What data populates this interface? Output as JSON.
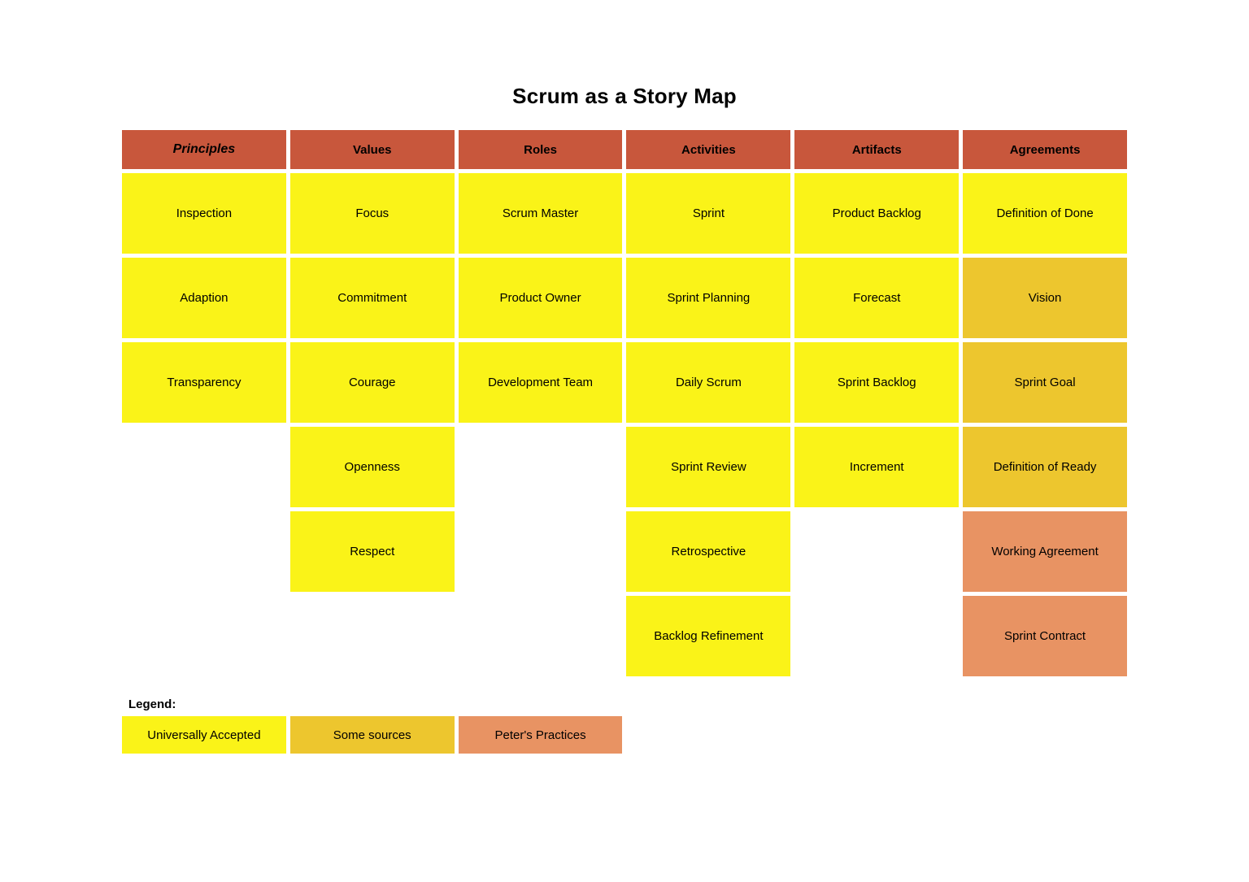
{
  "title": "Scrum as a Story Map",
  "palette": {
    "header": "#c8573c",
    "yellow": "#faf318",
    "gold": "#edc62e",
    "orange": "#e89363",
    "background": "#ffffff",
    "text": "#000000"
  },
  "columns": [
    {
      "header": "Principles",
      "header_style": "bold-italic",
      "cells": [
        {
          "label": "Inspection",
          "tone": "yellow"
        },
        {
          "label": "Adaption",
          "tone": "yellow"
        },
        {
          "label": "Transparency",
          "tone": "yellow"
        }
      ]
    },
    {
      "header": "Values",
      "header_style": "bold",
      "cells": [
        {
          "label": "Focus",
          "tone": "yellow"
        },
        {
          "label": "Commitment",
          "tone": "yellow"
        },
        {
          "label": "Courage",
          "tone": "yellow"
        },
        {
          "label": "Openness",
          "tone": "yellow"
        },
        {
          "label": "Respect",
          "tone": "yellow"
        }
      ]
    },
    {
      "header": "Roles",
      "header_style": "bold",
      "cells": [
        {
          "label": "Scrum Master",
          "tone": "yellow"
        },
        {
          "label": "Product Owner",
          "tone": "yellow"
        },
        {
          "label": "Development Team",
          "tone": "yellow"
        }
      ]
    },
    {
      "header": "Activities",
      "header_style": "bold",
      "cells": [
        {
          "label": "Sprint",
          "tone": "yellow"
        },
        {
          "label": "Sprint Planning",
          "tone": "yellow"
        },
        {
          "label": "Daily Scrum",
          "tone": "yellow"
        },
        {
          "label": "Sprint Review",
          "tone": "yellow"
        },
        {
          "label": "Retrospective",
          "tone": "yellow"
        },
        {
          "label": "Backlog Refinement",
          "tone": "yellow"
        }
      ]
    },
    {
      "header": "Artifacts",
      "header_style": "bold",
      "cells": [
        {
          "label": "Product Backlog",
          "tone": "yellow"
        },
        {
          "label": "Forecast",
          "tone": "yellow"
        },
        {
          "label": "Sprint Backlog",
          "tone": "yellow"
        },
        {
          "label": "Increment",
          "tone": "yellow"
        }
      ]
    },
    {
      "header": "Agreements",
      "header_style": "bold",
      "cells": [
        {
          "label": "Definition of Done",
          "tone": "yellow"
        },
        {
          "label": "Vision",
          "tone": "gold"
        },
        {
          "label": "Sprint Goal",
          "tone": "gold"
        },
        {
          "label": "Definition of Ready",
          "tone": "gold"
        },
        {
          "label": "Working Agreement",
          "tone": "orange"
        },
        {
          "label": "Sprint Contract",
          "tone": "orange"
        }
      ]
    }
  ],
  "legend": {
    "label": "Legend:",
    "items": [
      {
        "label": "Universally Accepted",
        "tone": "yellow"
      },
      {
        "label": "Some sources",
        "tone": "gold"
      },
      {
        "label": "Peter's Practices",
        "tone": "orange"
      }
    ]
  }
}
